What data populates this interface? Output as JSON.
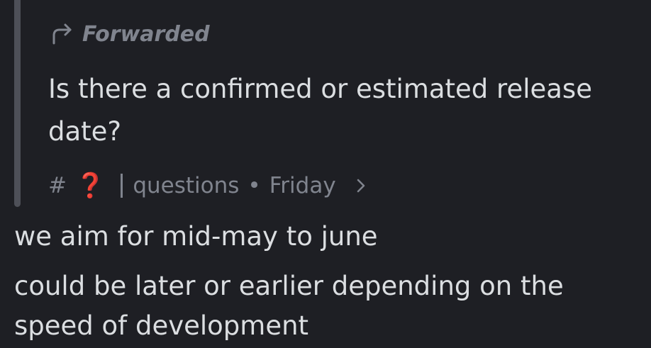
{
  "forwarded": {
    "icon": "forward-arrow-icon",
    "label": "Forwarded",
    "text": "Is there a confirmed or estimated release date?",
    "source": {
      "hash": "#",
      "emoji": "❓",
      "channel": "questions",
      "separator": "•",
      "time": "Friday",
      "chevron_icon": "chevron-right-icon"
    }
  },
  "messages": [
    "we aim for mid-may to june",
    "could be later or earlier depending on the speed of development"
  ],
  "colors": {
    "background": "#1e1f24",
    "text": "#dbdee1",
    "muted": "#80848e",
    "bar": "#4e5058",
    "emoji": "#dd2e44"
  }
}
